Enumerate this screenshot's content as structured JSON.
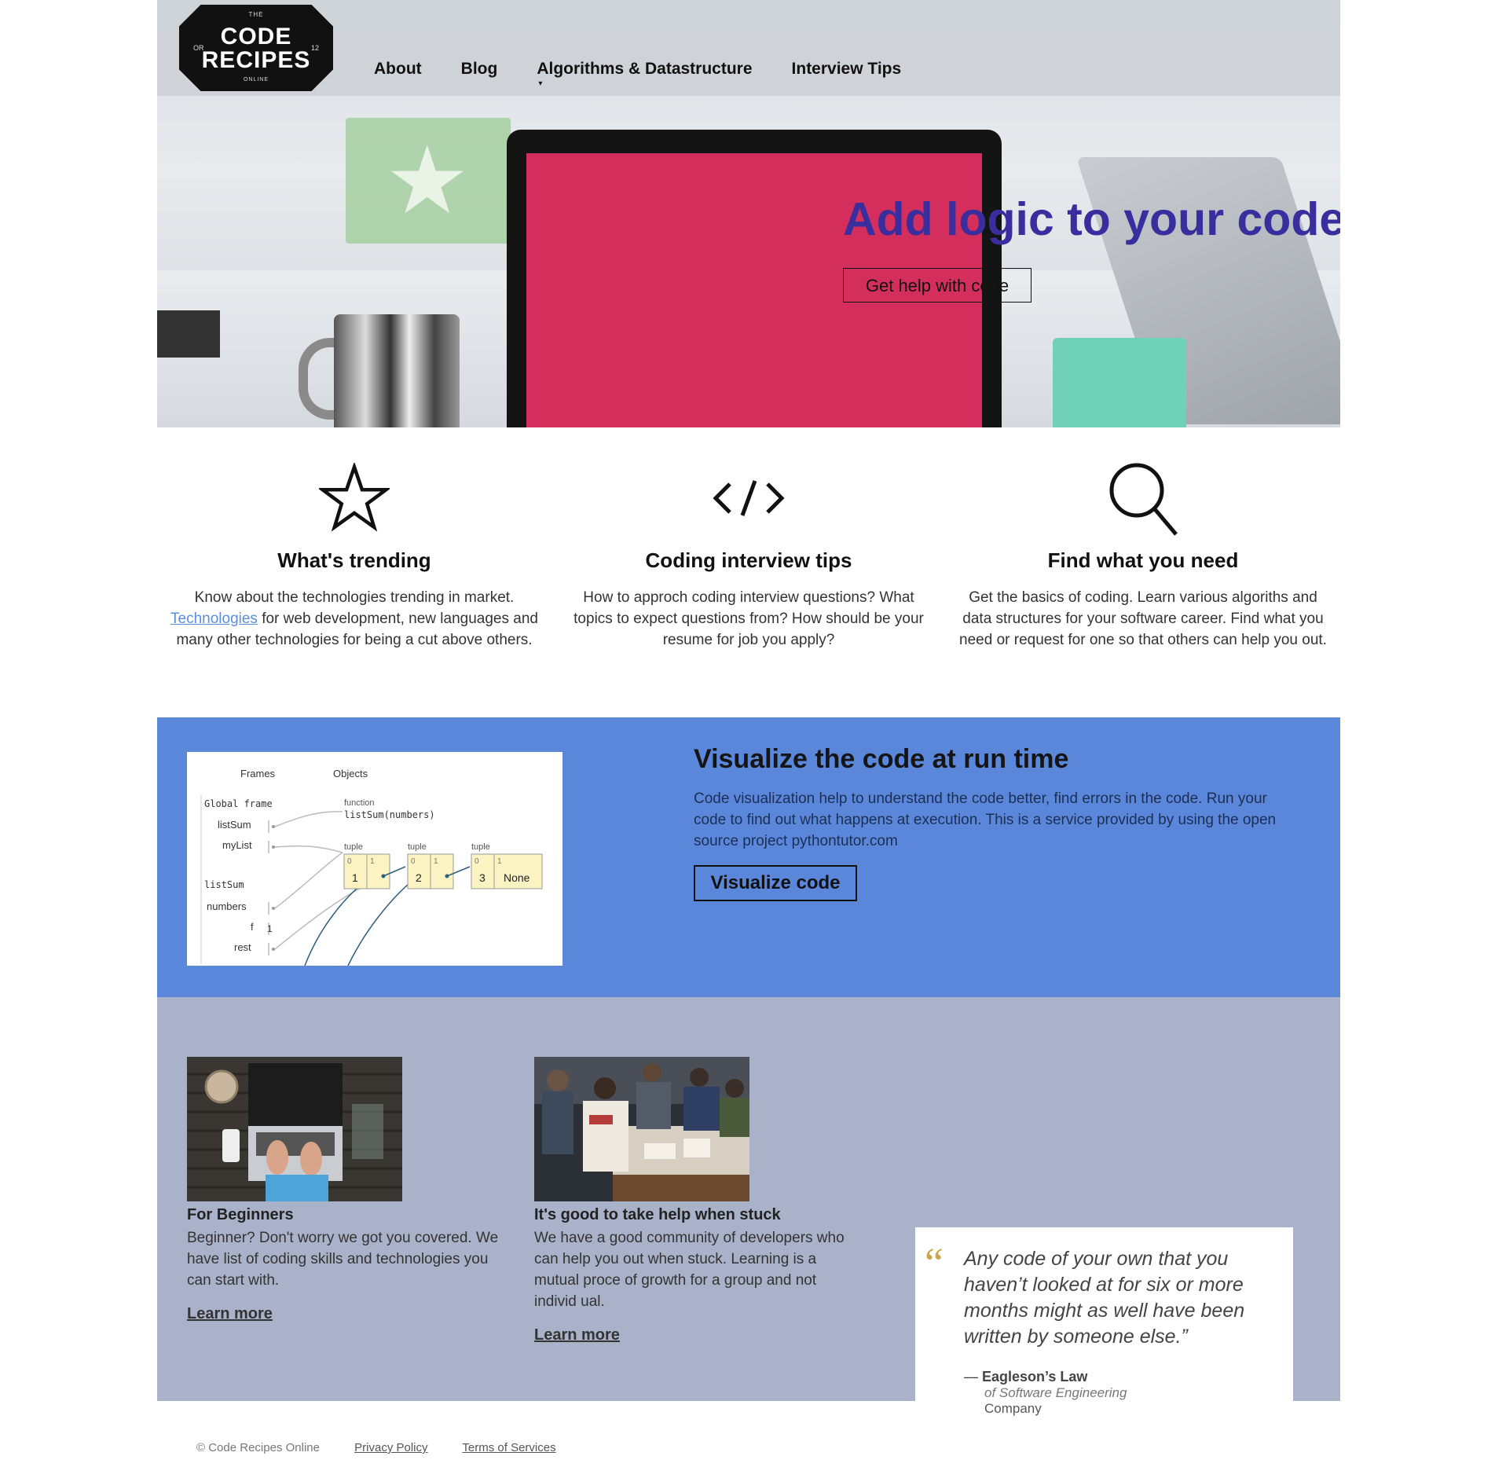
{
  "logo": {
    "top_text": "THE",
    "line1": "CODE",
    "line2": "RECIPES",
    "side_left": "OR",
    "side_right": "12",
    "bottom_text": "ONLINE"
  },
  "nav": {
    "items": [
      {
        "label": "About"
      },
      {
        "label": "Blog"
      },
      {
        "label": "Algorithms & Datastructure",
        "has_dropdown": true
      },
      {
        "label": "Interview Tips"
      }
    ]
  },
  "hero": {
    "title": "Add logic to your code",
    "cta": "Get help with code"
  },
  "features": [
    {
      "icon": "star-icon",
      "title": "What's trending",
      "text_before_link": "Know about the technologies trending in market.",
      "link": "Technologies",
      "text_after_link": " for web development, new languages and many other technologies for being a cut above others."
    },
    {
      "icon": "code-icon",
      "title": "Coding interview tips",
      "text": "How to approch coding interview questions? What topics to expect questions from? How should be your resume for job you apply?"
    },
    {
      "icon": "search-icon",
      "title": "Find what you need",
      "text": "Get the basics of coding. Learn various algoriths and data structures for your software career. Find what you need or request for one so that others can help you out."
    }
  ],
  "visualize": {
    "title": "Visualize the code at run time",
    "text": "Code visualization help to understand the code better, find errors in the code. Run your code to find out what happens at execution. This is a service provided by using the open source project pythontutor.com",
    "button": "Visualize code",
    "diagram": {
      "frames_label": "Frames",
      "objects_label": "Objects",
      "global_frame": "Global frame",
      "vars": [
        "listSum",
        "myList"
      ],
      "func_label": "function",
      "func_sig": "listSum(numbers)",
      "frame2": "listSum",
      "frame2_vars": [
        "numbers",
        "f",
        "rest"
      ],
      "f_value": "1",
      "tuple_label": "tuple",
      "tuples": [
        {
          "idx": [
            "0",
            "1"
          ],
          "val": "1"
        },
        {
          "idx": [
            "0",
            "1"
          ],
          "val": "2"
        },
        {
          "idx": [
            "0",
            "1"
          ],
          "val": "3",
          "last": "None"
        }
      ]
    }
  },
  "cards": [
    {
      "title": "For Beginners",
      "text": "Beginner? Don't worry we got you covered. We have list of coding skills and technologies you can start with.",
      "link": "Learn more"
    },
    {
      "title": "It's good to take help when stuck",
      "text": "We have a good community of developers who can help you out when stuck. Learning is a mutual proce of growth for a group and not individ ual.",
      "link": "Learn more"
    }
  ],
  "quote": {
    "mark": "“",
    "text": "Any code of your own that you haven’t looked at for six or more months might as well have been written by someone else.”",
    "dash": "—",
    "author": "Eagleson’s Law",
    "source": "of Software Engineering",
    "company": "Company"
  },
  "footer": {
    "copyright": "© Code Recipes Online",
    "links": [
      "Privacy Policy",
      "Terms of Services"
    ]
  },
  "colors": {
    "hero_title": "#3a2e9e",
    "viz_band": "#5b87da",
    "cards_band": "#a9b2c8",
    "quote_mark": "#c9a64b",
    "link": "#5a8fdb"
  }
}
